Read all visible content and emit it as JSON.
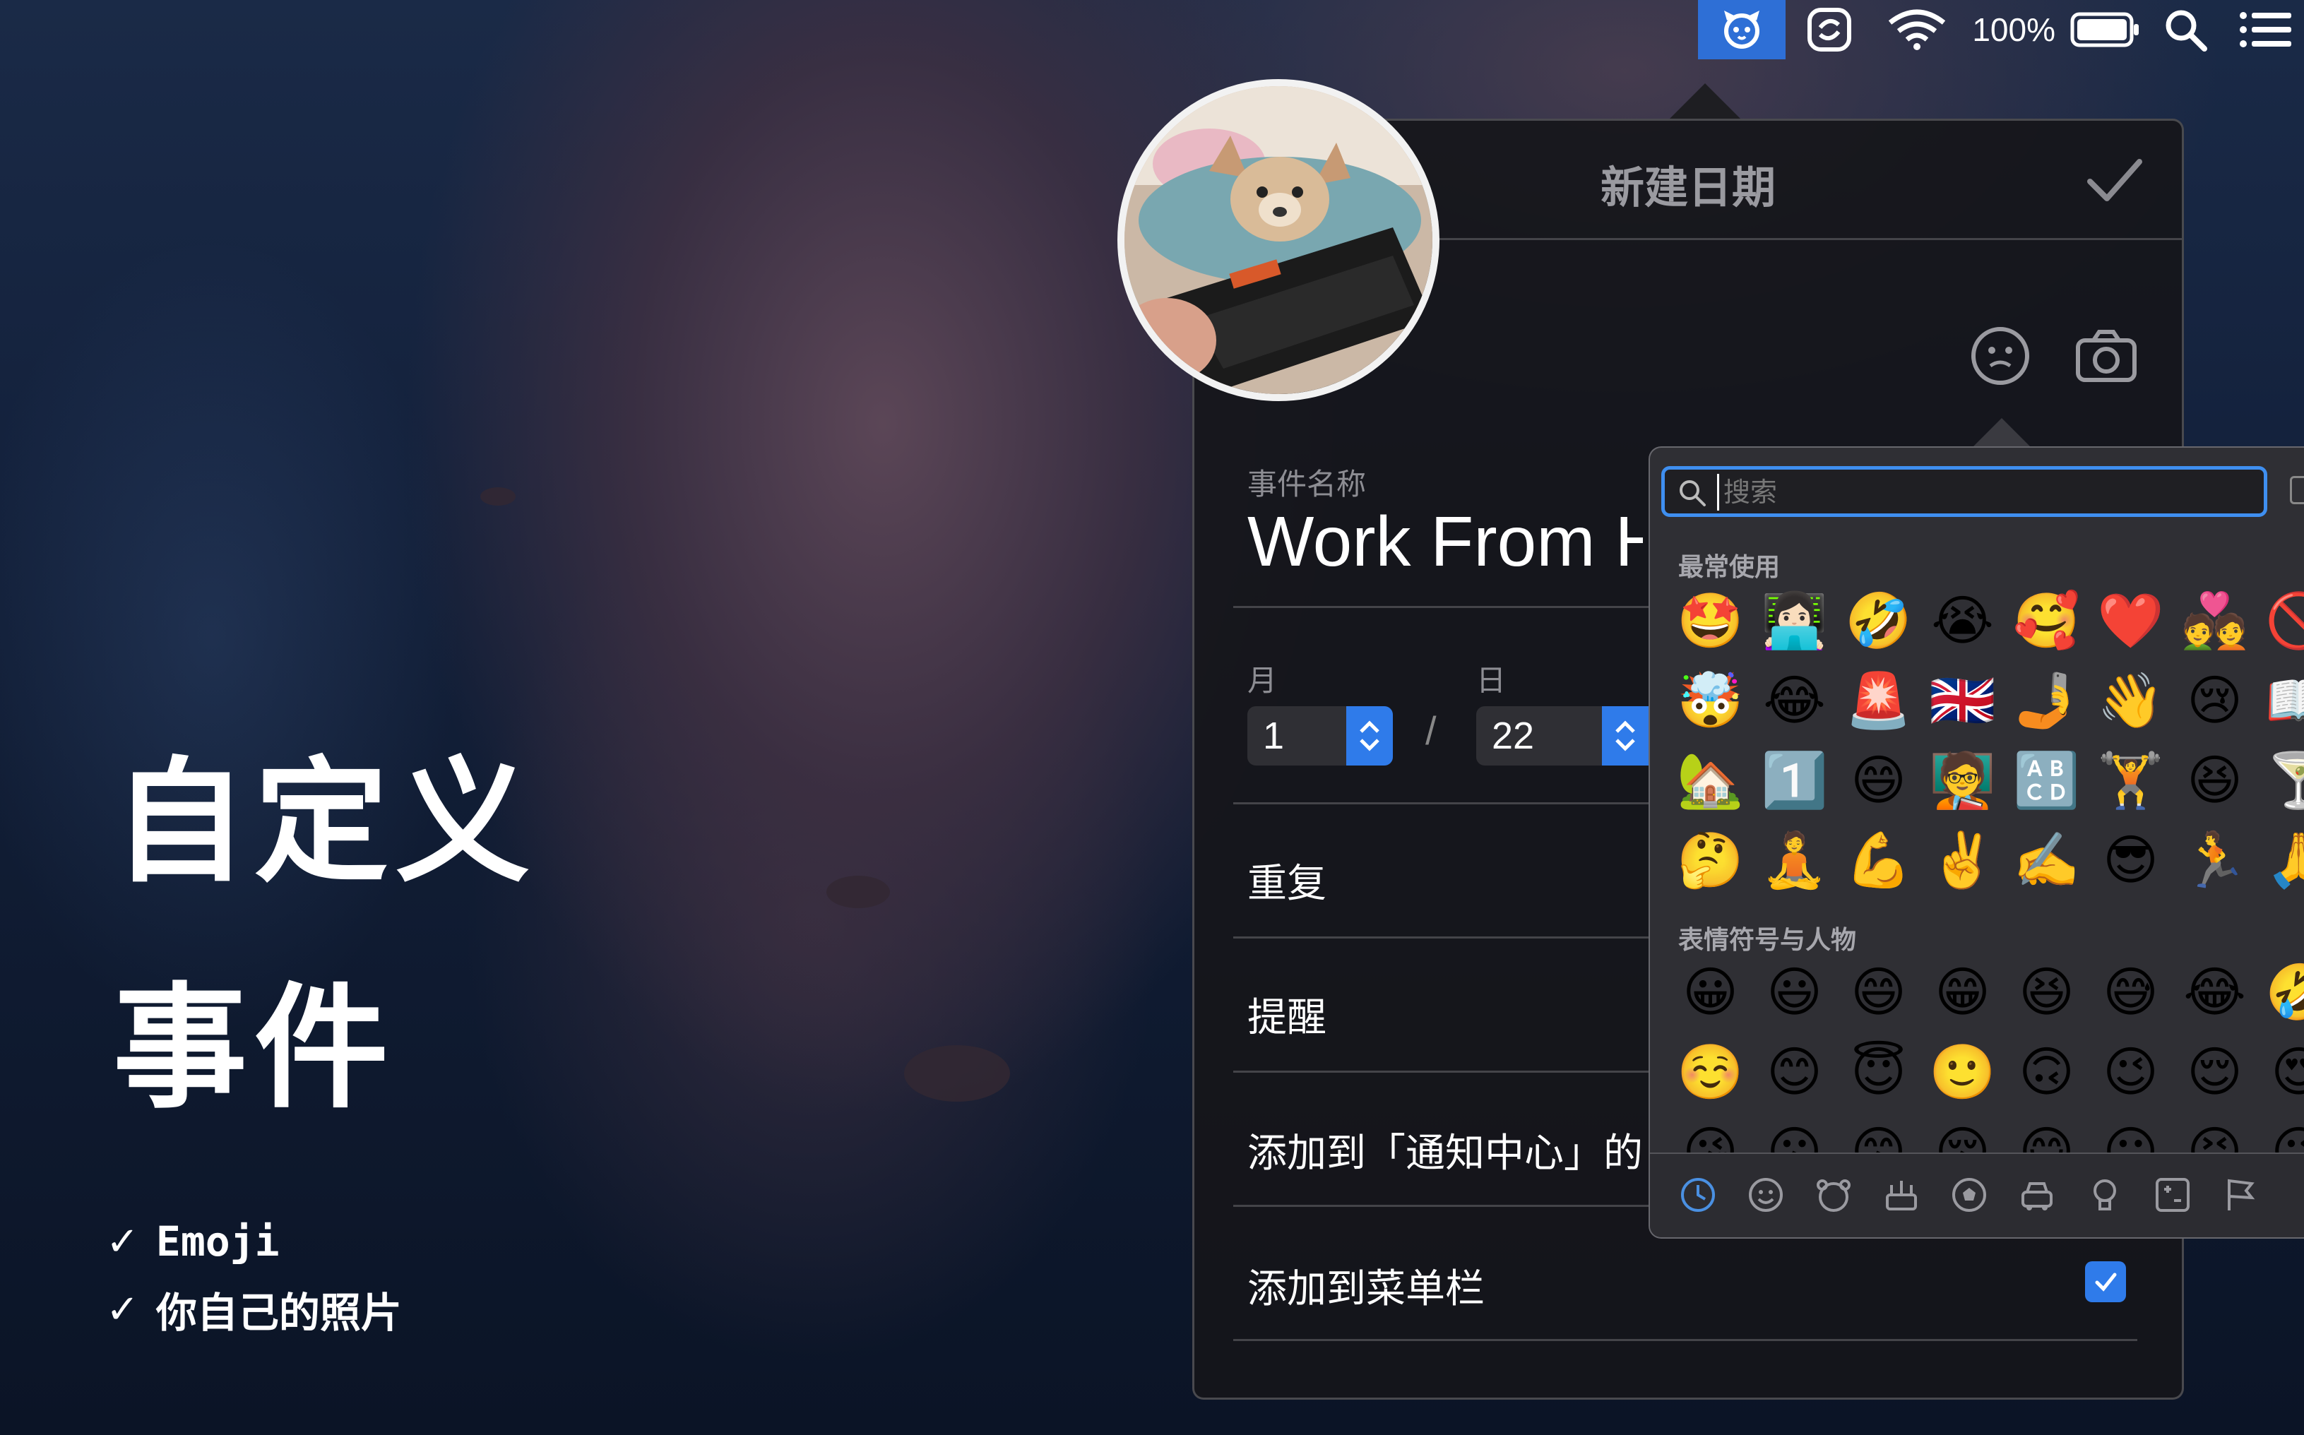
{
  "menubar": {
    "battery_percent": "100%",
    "icons": [
      "app-dog-icon",
      "app-sync-icon",
      "wifi-icon",
      "battery-icon",
      "search-icon",
      "list-icon"
    ],
    "accent": "#2e6fd6"
  },
  "promo": {
    "title_line1": "自定义",
    "title_line2": "事件",
    "features": [
      "Emoji",
      "你自己的照片"
    ]
  },
  "panel": {
    "title": "新建日期",
    "event_name_label": "事件名称",
    "event_name_value": "Work From H",
    "month_label": "月",
    "day_label": "日",
    "month_value": "1",
    "date_separator": "/",
    "day_value": "22",
    "rows": [
      "重复",
      "提醒",
      "添加到「通知中心」的",
      "添加到菜单栏"
    ],
    "menubar_checked": true,
    "accent": "#2f7bea"
  },
  "emoji_picker": {
    "search_placeholder": "搜索",
    "frequent_label": "最常使用",
    "frequent": [
      "🤩",
      "👩🏻‍💻",
      "🤣",
      "😭",
      "🥰",
      "❤️",
      "💑",
      "🚫",
      "🤯",
      "😂",
      "🚨",
      "🇬🇧",
      "🤳",
      "👋",
      "😢",
      "📖",
      "🏡",
      "1️⃣",
      "😄",
      "🧑‍🏫",
      "🔠",
      "🏋️",
      "😆",
      "🍸",
      "🤔",
      "🧘",
      "💪",
      "✌️",
      "✍️",
      "😎",
      "🏃",
      "🙏"
    ],
    "smileys_label": "表情符号与人物",
    "smileys": [
      "😀",
      "😃",
      "😄",
      "😁",
      "😆",
      "😅",
      "😂",
      "🤣",
      "☺️",
      "😊",
      "😇",
      "🙂",
      "🙃",
      "😉",
      "😌",
      "😍",
      "😘",
      "😗",
      "😙",
      "😚",
      "😋",
      "😛",
      "😝",
      "😜"
    ],
    "tabs": [
      "clock-icon",
      "smiley-icon",
      "bear-icon",
      "food-icon",
      "ball-icon",
      "car-icon",
      "bulb-icon",
      "symbols-icon",
      "flag-icon"
    ]
  }
}
